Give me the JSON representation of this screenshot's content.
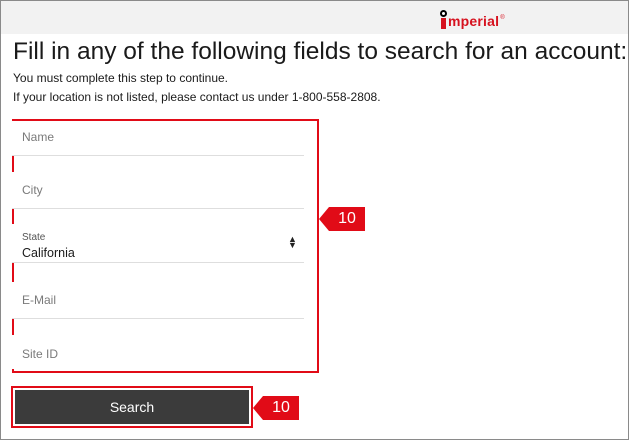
{
  "header": {
    "logo_text": "mperial",
    "logo_tm": "®",
    "logo_icon": "imperial-logo-icon"
  },
  "page": {
    "title": "Fill in any of the following fields to search for an account:",
    "instruction": "You must complete this step to continue.",
    "contact_note": "If your location is not listed, please contact us under 1-800-558-2808."
  },
  "form": {
    "name_placeholder": "Name",
    "city_placeholder": "City",
    "state_label": "State",
    "state_value": "California",
    "email_placeholder": "E-Mail",
    "site_id_placeholder": "Site ID"
  },
  "search_button_label": "Search",
  "callouts": {
    "form_step": "10",
    "search_step": "10"
  },
  "colors": {
    "accent_red": "#e10b17",
    "logo_red": "#d6121f",
    "button_dark": "#3b3b3b",
    "header_bg": "#f2f2f2"
  }
}
